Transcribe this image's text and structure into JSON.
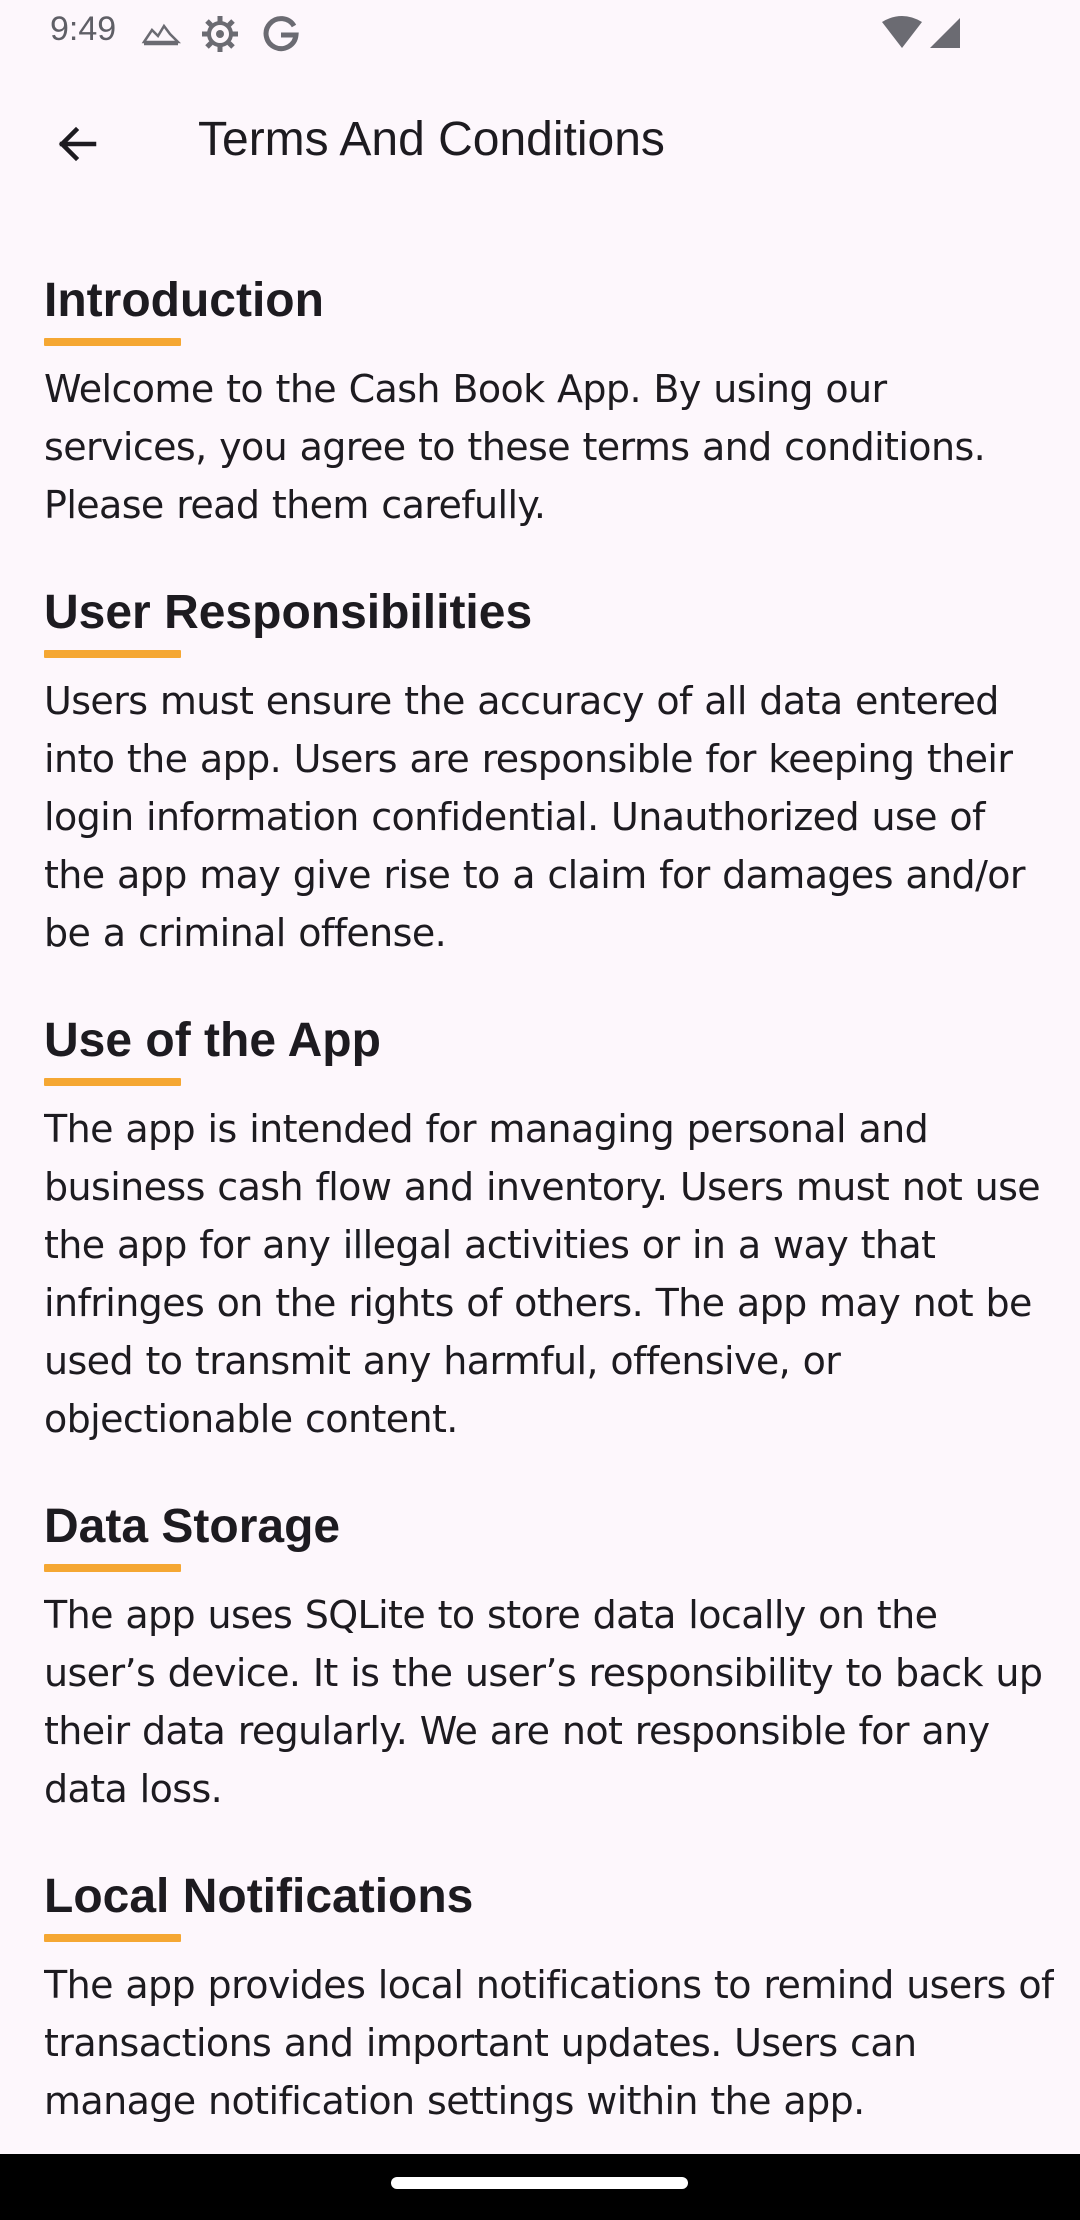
{
  "status_bar": {
    "time": "9:49"
  },
  "app_bar": {
    "title": "Terms And Conditions"
  },
  "sections": [
    {
      "title": "Introduction",
      "body": "Welcome to the Cash Book App. By using our services, you agree to these terms and conditions. Please read them carefully."
    },
    {
      "title": "User Responsibilities",
      "body": "Users must ensure the accuracy of all data entered into the app. Users are responsible for keeping their login information confidential. Unauthorized use of the app may give rise to a claim for damages and/or be a criminal offense."
    },
    {
      "title": "Use of the App",
      "body": "The app is intended for managing personal and business cash flow and inventory. Users must not use the app for any illegal activities or in a way that infringes on the rights of others. The app may not be used to transmit any harmful, offensive, or objectionable content."
    },
    {
      "title": "Data Storage",
      "body": "The app uses SQLite to store data locally on the user’s device. It is the user’s responsibility to back up their data regularly. We are not responsible for any data loss."
    },
    {
      "title": "Local Notifications",
      "body": "The app provides local notifications to remind users of transactions and important updates. Users can manage notification settings within the app."
    }
  ],
  "colors": {
    "accent_underline": "#f5a733",
    "background": "#fdf7fc"
  },
  "icons": {
    "back": "arrow-left-icon",
    "status": [
      "cloud-icon",
      "gear-icon",
      "google-icon",
      "wifi-icon",
      "signal-icon"
    ]
  }
}
